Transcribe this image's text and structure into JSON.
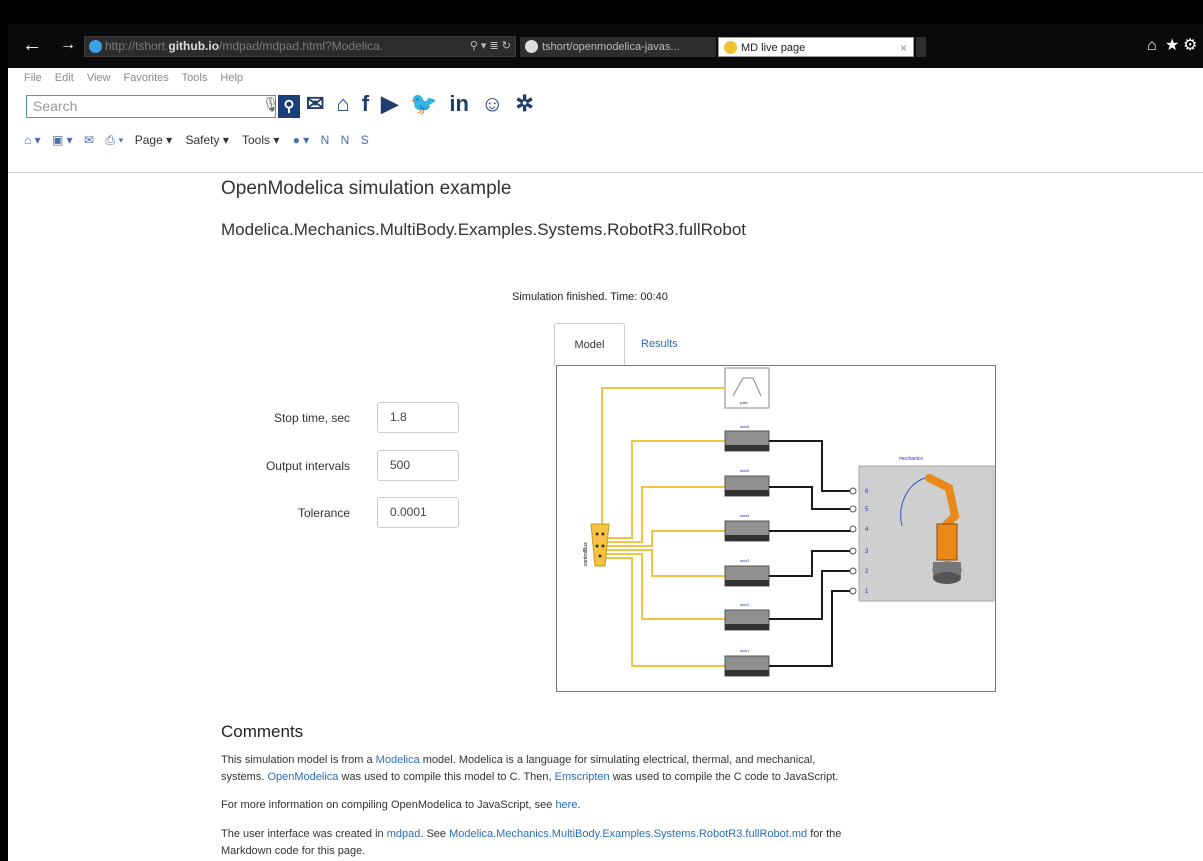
{
  "browser": {
    "address": {
      "prefix": "http://tshort.",
      "domain": "github.io",
      "path": "/mdpad/mdpad.html?Modelica.",
      "controls": "⚲ ▾ ≣ ↻"
    },
    "tabs": [
      {
        "label": "tshort/openmodelica-javas..."
      },
      {
        "label": "MD live page",
        "close": "×"
      }
    ],
    "menu": [
      "File",
      "Edit",
      "View",
      "Favorites",
      "Tools",
      "Help"
    ],
    "search_placeholder": "Search",
    "command_items": [
      "Page ▾",
      "Safety ▾",
      "Tools ▾"
    ]
  },
  "page": {
    "title": "OpenModelica simulation example",
    "model_name": "Modelica.Mechanics.MultiBody.Examples.Systems.RobotR3.fullRobot",
    "status": "Simulation finished.   Time: 00:40",
    "fields": [
      {
        "label": "Stop time, sec",
        "value": "1.8"
      },
      {
        "label": "Output intervals",
        "value": "500"
      },
      {
        "label": "Tolerance",
        "value": "0.0001"
      }
    ],
    "tabs": {
      "model": "Model",
      "results": "Results"
    },
    "diagram": {
      "mechanics_label": "mechanics",
      "bus_label": "controlBus",
      "axis_labels": [
        "axis6",
        "axis5",
        "axis4",
        "axis3",
        "axis2",
        "axis1"
      ],
      "port_labels": [
        "6",
        "5",
        "4",
        "3",
        "2",
        "1"
      ],
      "path_label": "path"
    },
    "comments_heading": "Comments",
    "comments": {
      "p1_a": "This simulation model is from a ",
      "p1_link1": "Modelica",
      "p1_b": " model. Modelica is a language for simulating electrical, thermal, and mechanical,",
      "p1_c": "systems. ",
      "p1_link2": "OpenModelica",
      "p1_d": " was used to compile this model to C. Then, ",
      "p1_link3": "Emscripten",
      "p1_e": " was used to compile the C code to JavaScript.",
      "p2_a": "For more information on compiling OpenModelica to JavaScript, see ",
      "p2_link": "here",
      "p2_b": ".",
      "p3_a": "The user interface was created in ",
      "p3_link1": "mdpad",
      "p3_b": ". See ",
      "p3_link2": "Modelica.Mechanics.MultiBody.Examples.Systems.RobotR3.fullRobot.md",
      "p3_c": " for the",
      "p4": "Markdown code for this page."
    }
  },
  "colors": {
    "link": "#2a6ebb",
    "bus_wire": "#f5c242",
    "signal_wire": "#1a1a1a"
  }
}
